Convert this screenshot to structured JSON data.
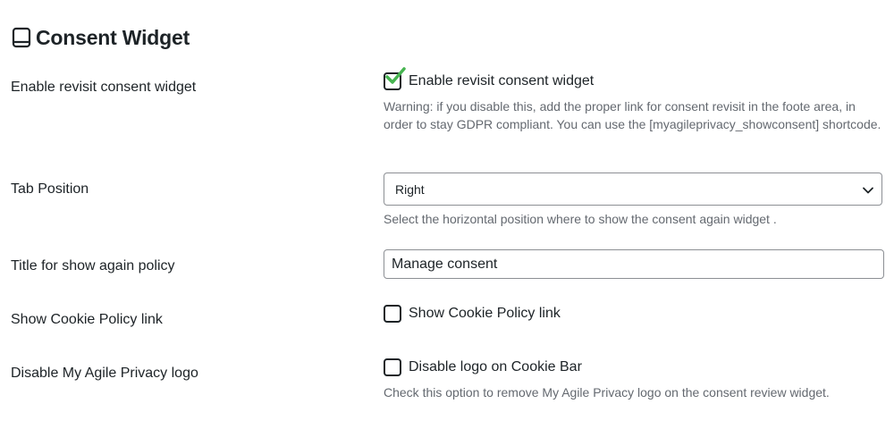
{
  "section": {
    "icon": "tablet-icon",
    "title": "Consent Widget"
  },
  "rows": {
    "revisit": {
      "label": "Enable revisit consent widget",
      "checkbox_label": "Enable revisit consent widget",
      "checked": true,
      "description": "Warning: if you disable this, add the proper link for consent revisit in the foote area, in order to stay GDPR compliant. You can use the [myagileprivacy_showconsent] shortcode."
    },
    "tab_position": {
      "label": "Tab Position",
      "selected": "Right",
      "description": "Select the horizontal position where to show the consent again widget ."
    },
    "title_policy": {
      "label": "Title for show again policy",
      "value": "Manage consent"
    },
    "cookie_policy": {
      "label": "Show Cookie Policy link",
      "checkbox_label": "Show Cookie Policy link",
      "checked": false
    },
    "disable_logo": {
      "label": "Disable My Agile Privacy logo",
      "checkbox_label": "Disable logo on Cookie Bar",
      "checked": false,
      "description": "Check this option to remove My Agile Privacy logo on the consent review widget."
    }
  },
  "colors": {
    "check_green": "#46b450",
    "muted_text": "#646970",
    "border": "#8c8f94"
  }
}
